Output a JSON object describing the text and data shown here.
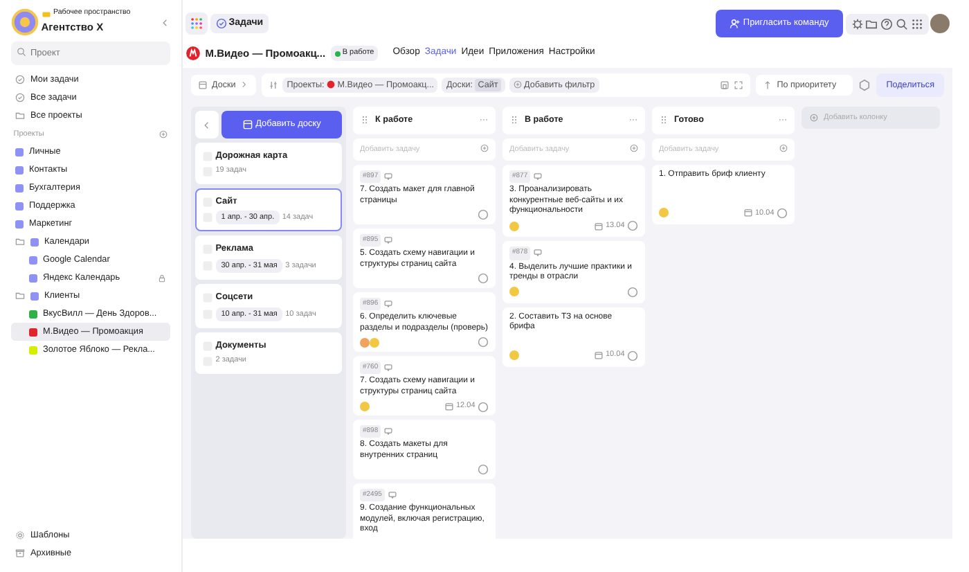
{
  "sidebar": {
    "workspace_label": "Рабочее пространство",
    "workspace_name": "Агентство X",
    "search": {
      "placeholder": "Проект"
    },
    "nav": [
      {
        "label": "Мои задачи",
        "kind": "check"
      },
      {
        "label": "Все задачи",
        "kind": "check"
      },
      {
        "label": "Все проекты",
        "kind": "folder"
      }
    ],
    "projects_heading": "Проекты",
    "projects": [
      {
        "label": "Личные",
        "kind": "project",
        "color": "#8e92f4",
        "selected": false
      },
      {
        "label": "Контакты",
        "kind": "project",
        "color": "#8e92f4",
        "selected": false
      },
      {
        "label": "Бухгалтерия",
        "kind": "project",
        "color": "#8e92f4",
        "selected": false
      },
      {
        "label": "Поддержка",
        "kind": "project",
        "color": "#8e92f4",
        "selected": false
      },
      {
        "label": "Маркетинг",
        "kind": "project",
        "color": "#8e92f4",
        "selected": false
      },
      {
        "label": "Календари",
        "kind": "folder",
        "color": "#8e92f4",
        "selected": false,
        "children": [
          {
            "label": "Google Calendar",
            "color": "#8e92f4",
            "locked": false,
            "selected": false
          },
          {
            "label": "Яндекс Календарь",
            "color": "#8e92f4",
            "locked": true,
            "selected": false
          }
        ]
      },
      {
        "label": "Клиенты",
        "kind": "folder",
        "color": "#8e92f4",
        "selected": false,
        "children": [
          {
            "label": "ВкусВилл — День Здоров...",
            "color": "#2fb14a",
            "locked": false,
            "selected": false
          },
          {
            "label": "М.Видео — Промоакция",
            "color": "#e3232c",
            "locked": false,
            "selected": true
          },
          {
            "label": "Золотое Яблоко — Рекла...",
            "color": "#d4ef00",
            "locked": false,
            "selected": false
          }
        ]
      }
    ],
    "footer": [
      {
        "label": "Шаблоны",
        "kind": "template"
      },
      {
        "label": "Архивные",
        "kind": "archive"
      }
    ]
  },
  "topbar": {
    "section": "Задачи",
    "invite_button": "Пригласить команду"
  },
  "project_header": {
    "title": "М.Видео — Промоакц...",
    "status": "В работе",
    "tabs": [
      {
        "label": "Обзор",
        "selected": false
      },
      {
        "label": "Задачи",
        "selected": true
      },
      {
        "label": "Идеи",
        "selected": false
      },
      {
        "label": "Приложения",
        "selected": false
      },
      {
        "label": "Настройки",
        "selected": false
      }
    ]
  },
  "filters": {
    "boards_toggle": "Доски",
    "projects_label": "Проекты:",
    "projects_value": "М.Видео — Промоакц...",
    "boards_label": "Доски:",
    "boards_value": "Сайт",
    "add_filter": "Добавить фильтр",
    "sort": "По приоритету",
    "share": "Поделиться"
  },
  "boards_panel": {
    "add_button": "Добавить доску",
    "boards": [
      {
        "name": "Дорожная карта",
        "count": "19 задач",
        "selected": false
      },
      {
        "name": "Сайт",
        "dates": "1 апр. - 30 апр.",
        "count": "14 задач",
        "selected": true
      },
      {
        "name": "Реклама",
        "dates": "30 апр. - 31 мая",
        "count": "3 задачи",
        "selected": false
      },
      {
        "name": "Соцсети",
        "dates": "10 апр. - 31 мая",
        "count": "10 задач",
        "selected": false
      },
      {
        "name": "Документы",
        "count": "2 задачи",
        "selected": false
      }
    ]
  },
  "columns": [
    {
      "title": "К работе",
      "add_placeholder": "Добавить задачу",
      "tasks": [
        {
          "id": "#897",
          "title": "7. Создать макет для главной страницы"
        },
        {
          "id": "#895",
          "title": "5. Создать схему навигации и структуры страниц сайта"
        },
        {
          "id": "#896",
          "title": "6. Определить ключевые разделы и подразделы (проверь)",
          "assignees": [
            {
              "color": "#f0a35e"
            },
            {
              "color": "#f2c744"
            }
          ]
        },
        {
          "id": "#760",
          "title": "7. Создать схему навигации и структуры страниц сайта",
          "assignees": [
            {
              "color": "#f2c744"
            }
          ],
          "due": "12.04"
        },
        {
          "id": "#898",
          "title": "8. Создать макеты для внутренних страниц"
        },
        {
          "id": "#2495",
          "title": "9. Создание функциональных модулей, включая регистрацию, вход"
        }
      ]
    },
    {
      "title": "В работе",
      "add_placeholder": "Добавить задачу",
      "tasks": [
        {
          "id": "#877",
          "title": "3. Проанализировать конкурентные веб-сайты и их функциональности",
          "assignees": [
            {
              "color": "#f2c744"
            }
          ],
          "due": "13.04"
        },
        {
          "id": "#878",
          "title": "4. Выделить лучшие практики и тренды в отрасли",
          "assignees": [
            {
              "color": "#f2c744"
            }
          ]
        },
        {
          "title": "2. Составить ТЗ на основе брифа",
          "assignees": [
            {
              "color": "#f2c744"
            }
          ],
          "due": "10.04"
        }
      ]
    },
    {
      "title": "Готово",
      "add_placeholder": "Добавить задачу",
      "tasks": [
        {
          "title": "1. Отправить бриф клиенту",
          "assignees": [
            {
              "color": "#f2c744"
            }
          ],
          "due": "10.04"
        }
      ]
    }
  ],
  "add_column": "Добавить колонку"
}
